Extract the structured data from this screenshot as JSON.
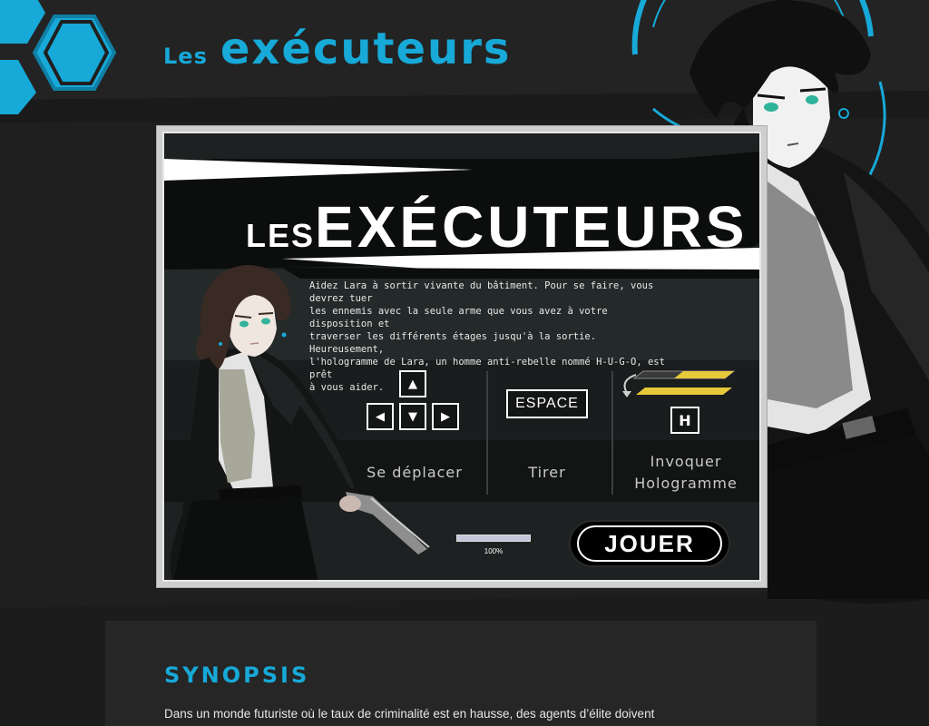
{
  "site": {
    "title_small": "Les",
    "title_big": "EXÉCUTEURS",
    "accent_color": "#17a9d8"
  },
  "game": {
    "logo_small": "LES",
    "logo_big": "EXÉCUTEURS",
    "intro_lines": [
      "Aidez Lara à sortir vivante du bâtiment. Pour se faire, vous devrez tuer",
      "les ennemis avec la seule arme que vous avez à votre disposition et",
      "traverser les différents étages jusqu'à la sortie. Heureusement,",
      "l'hologramme de Lara, un homme anti-rebelle nommé H-U-G-O, est prêt",
      "à vous aider."
    ],
    "controls": {
      "move_label": "Se déplacer",
      "move_keys": {
        "up": "▲",
        "left": "◀",
        "down": "▼",
        "right": "▶"
      },
      "shoot_label": "Tirer",
      "shoot_key": "ESPACE",
      "hologram_label_line1": "Invoquer",
      "hologram_label_line2": "Hologramme",
      "hologram_key": "H",
      "swap_icon": "swap-arrow-icon"
    },
    "loading_progress": 1.0,
    "loading_text": "100%",
    "play_label": "JOUER"
  },
  "synopsis": {
    "title": "SYNOPSIS",
    "text": "Dans un monde futuriste où le taux de criminalité est en hausse, des agents d’élite doivent"
  }
}
